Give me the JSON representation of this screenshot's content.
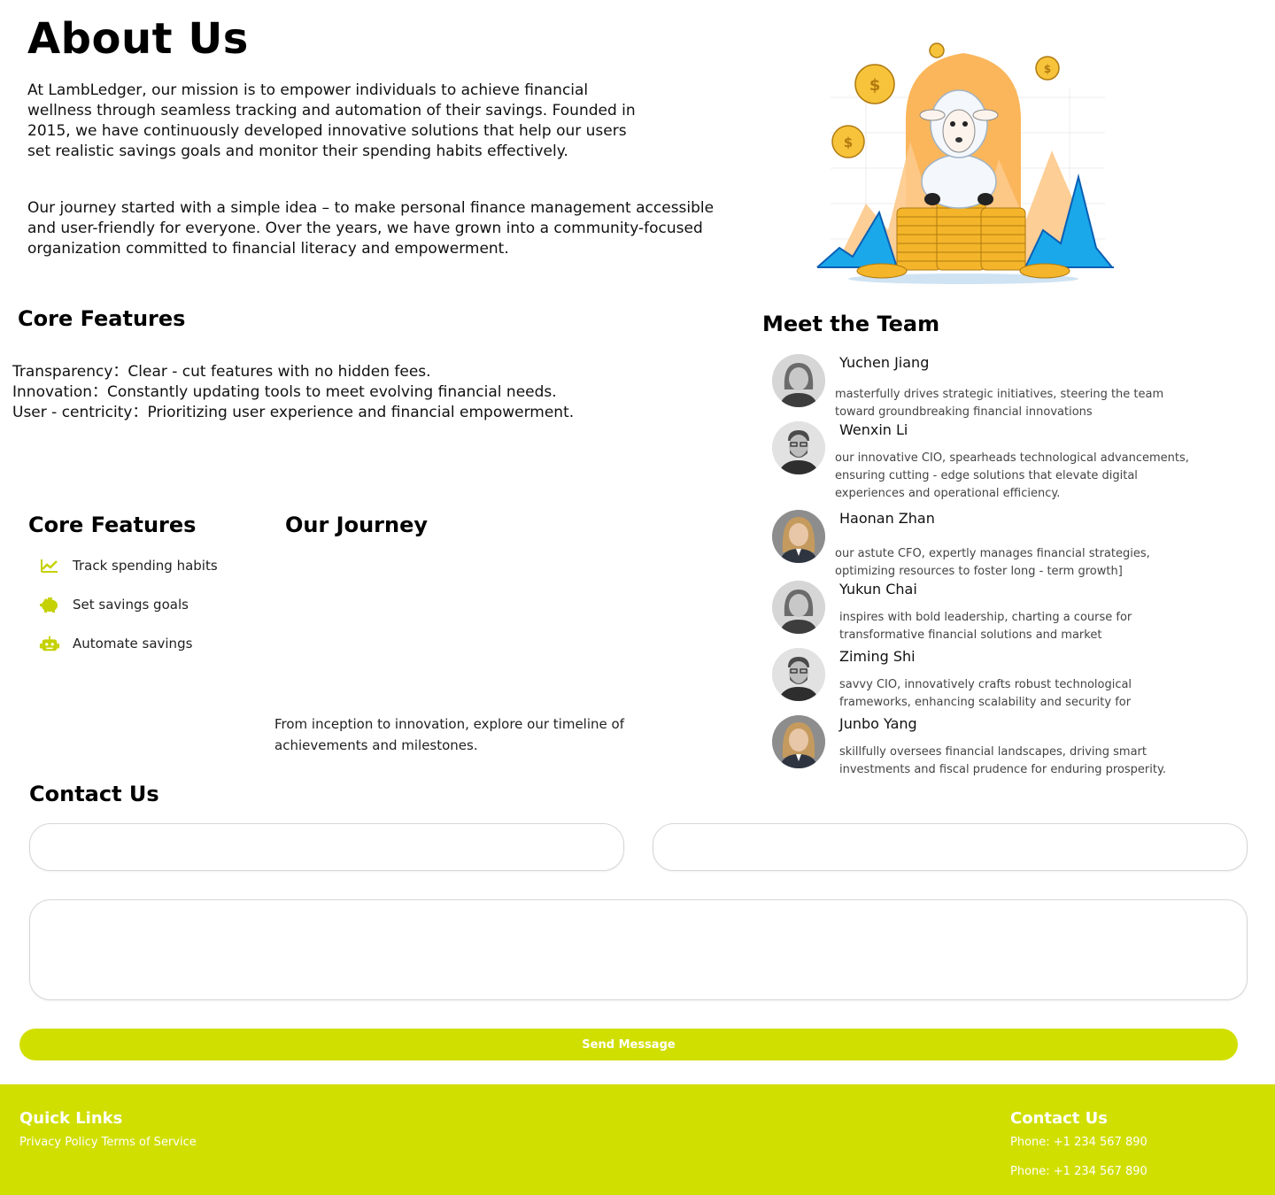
{
  "about": {
    "title": "About Us",
    "intro": "At LambLedger, our mission is to empower individuals to achieve financial wellness through seamless tracking and automation of their savings. Founded in 2015, we have continuously developed innovative solutions that help our users set realistic savings goals and monitor their spending habits effectively.",
    "journey_paragraph": "Our journey started with a simple idea – to make personal finance management accessible and user-friendly for everyone. Over the years, we have grown into a community-focused organization committed to financial literacy and empowerment."
  },
  "core_features_text": {
    "title": "Core Features",
    "rows": [
      {
        "label": "Transparency：",
        "text": "Clear - cut features with no hidden fees."
      },
      {
        "label": "Innovation：",
        "text": "Constantly updating tools to meet evolving financial needs."
      },
      {
        "label": "User - centricity：",
        "text": "Prioritizing user experience and financial empowerment."
      }
    ]
  },
  "core_features_list": {
    "title": "Core Features",
    "items": [
      {
        "label": "Track spending habits",
        "icon": "chart-line-icon"
      },
      {
        "label": "Set savings goals",
        "icon": "piggy-bank-icon"
      },
      {
        "label": "Automate savings",
        "icon": "robot-icon"
      }
    ]
  },
  "journey": {
    "title": "Our Journey",
    "text": "From inception to innovation, explore our timeline of achievements and milestones."
  },
  "team": {
    "title": "Meet the Team",
    "members": [
      {
        "name": "Yuchen Jiang",
        "desc": "masterfully drives strategic initiatives, steering the team toward groundbreaking financial innovations",
        "avatar": "woman"
      },
      {
        "name": "Wenxin Li",
        "desc": "our innovative CIO, spearheads technological advancements, ensuring cutting - edge solutions that elevate digital experiences and operational efficiency.",
        "avatar": "man"
      },
      {
        "name": "Haonan Zhan",
        "desc": "our astute CFO, expertly manages financial strategies, optimizing resources to foster long - term growth]",
        "avatar": "woman-blonde"
      },
      {
        "name": "Yukun Chai",
        "desc": "inspires with bold leadership, charting a course for transformative financial solutions and market",
        "avatar": "woman"
      },
      {
        "name": "Ziming Shi",
        "desc": "savvy CIO, innovatively crafts robust technological frameworks, enhancing scalability and security for",
        "avatar": "man"
      },
      {
        "name": "Junbo Yang",
        "desc": "skillfully oversees financial landscapes, driving smart investments and fiscal prudence for enduring prosperity.",
        "avatar": "woman-blonde"
      }
    ]
  },
  "contact": {
    "title": "Contact Us",
    "name_value": "",
    "email_value": "",
    "message_value": "",
    "send_label": "Send Message"
  },
  "footer": {
    "quick_links_title": "Quick Links",
    "privacy": "Privacy Policy",
    "terms": "Terms of Service",
    "contact_title": "Contact Us",
    "phone_1": "Phone: +1 234 567 890",
    "phone_2": "Phone: +1 234 567 890"
  },
  "colors": {
    "accent": "#d1df00",
    "text": "#111111"
  }
}
